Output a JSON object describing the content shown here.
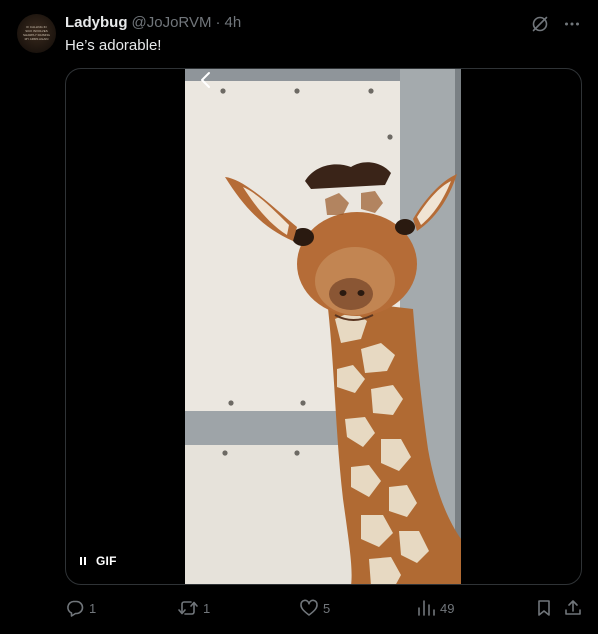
{
  "tweet": {
    "author_name": "Ladybug",
    "handle": "@JoJoRVM",
    "separator": "·",
    "time": "4h",
    "text": "He’s adorable!",
    "avatar_caption": "IF CALLING IN SICK INVOLVES SHARPLY RAISING MY ARMS AGAIN",
    "media": {
      "type": "GIF",
      "badge_label": "GIF",
      "state": "playing"
    },
    "stats": {
      "replies": "1",
      "reposts": "1",
      "likes": "5",
      "views": "49"
    }
  },
  "icons": {
    "grok": "grok-icon",
    "more": "more-icon",
    "reply": "reply-icon",
    "repost": "repost-icon",
    "like": "heart-icon",
    "views": "views-icon",
    "bookmark": "bookmark-icon",
    "share": "share-icon",
    "pause": "pause-icon",
    "back": "chevron-left-icon"
  },
  "colors": {
    "background": "#000000",
    "text": "#e7e9ea",
    "secondary": "#71767b",
    "border": "#2f3336"
  }
}
